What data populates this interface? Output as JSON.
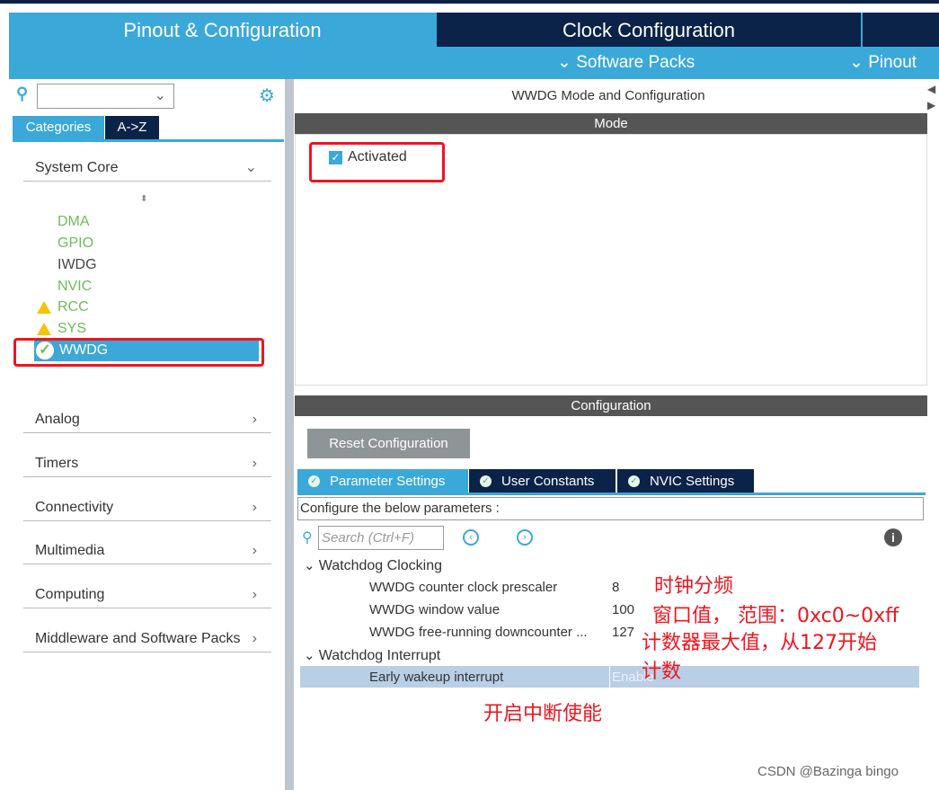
{
  "header": {
    "tabs": [
      {
        "label": "Pinout & Configuration",
        "active": true
      },
      {
        "label": "Clock Configuration"
      }
    ],
    "software_packs": "Software Packs",
    "pinout": "Pinout"
  },
  "sidebar": {
    "search_value": "",
    "tabs": [
      "Categories",
      "A->Z"
    ],
    "system_core": "System Core",
    "items": [
      {
        "label": "DMA",
        "status": "ok"
      },
      {
        "label": "GPIO",
        "status": "ok"
      },
      {
        "label": "IWDG",
        "status": "none"
      },
      {
        "label": "NVIC",
        "status": "ok"
      },
      {
        "label": "RCC",
        "status": "warning"
      },
      {
        "label": "SYS",
        "status": "warning"
      },
      {
        "label": "WWDG",
        "status": "selected"
      }
    ],
    "groups": [
      "Analog",
      "Timers",
      "Connectivity",
      "Multimedia",
      "Computing",
      "Middleware and Software Packs"
    ]
  },
  "main": {
    "title": "WWDG Mode and Configuration",
    "mode_bar": "Mode",
    "activated_label": "Activated",
    "activated": true,
    "config_bar": "Configuration",
    "reset_button": "Reset Configuration",
    "tabs": [
      "Parameter Settings",
      "User Constants",
      "NVIC Settings"
    ],
    "configure_text": "Configure the below parameters :",
    "search_placeholder": "Search (Ctrl+F)",
    "sections": [
      {
        "title": "Watchdog Clocking",
        "params": [
          {
            "name": "WWDG counter clock prescaler",
            "value": "8"
          },
          {
            "name": "WWDG window value",
            "value": "100"
          },
          {
            "name": "WWDG free-running downcounter ...",
            "value": "127"
          }
        ]
      },
      {
        "title": "Watchdog Interrupt",
        "params": [
          {
            "name": "Early wakeup interrupt",
            "value": "Enable"
          }
        ]
      }
    ]
  },
  "annotations": [
    "时钟分频",
    "窗口值， 范围：0xc0~0xff",
    "计数器最大值，从127开始",
    "计数",
    "开启中断使能"
  ],
  "watermark": "CSDN @Bazinga bingo",
  "colors": {
    "accent": "#3ba8da",
    "navy": "#0b2249",
    "ok": "#6dbb5a",
    "warning": "#f5c400",
    "annotation": "#f0141e"
  }
}
